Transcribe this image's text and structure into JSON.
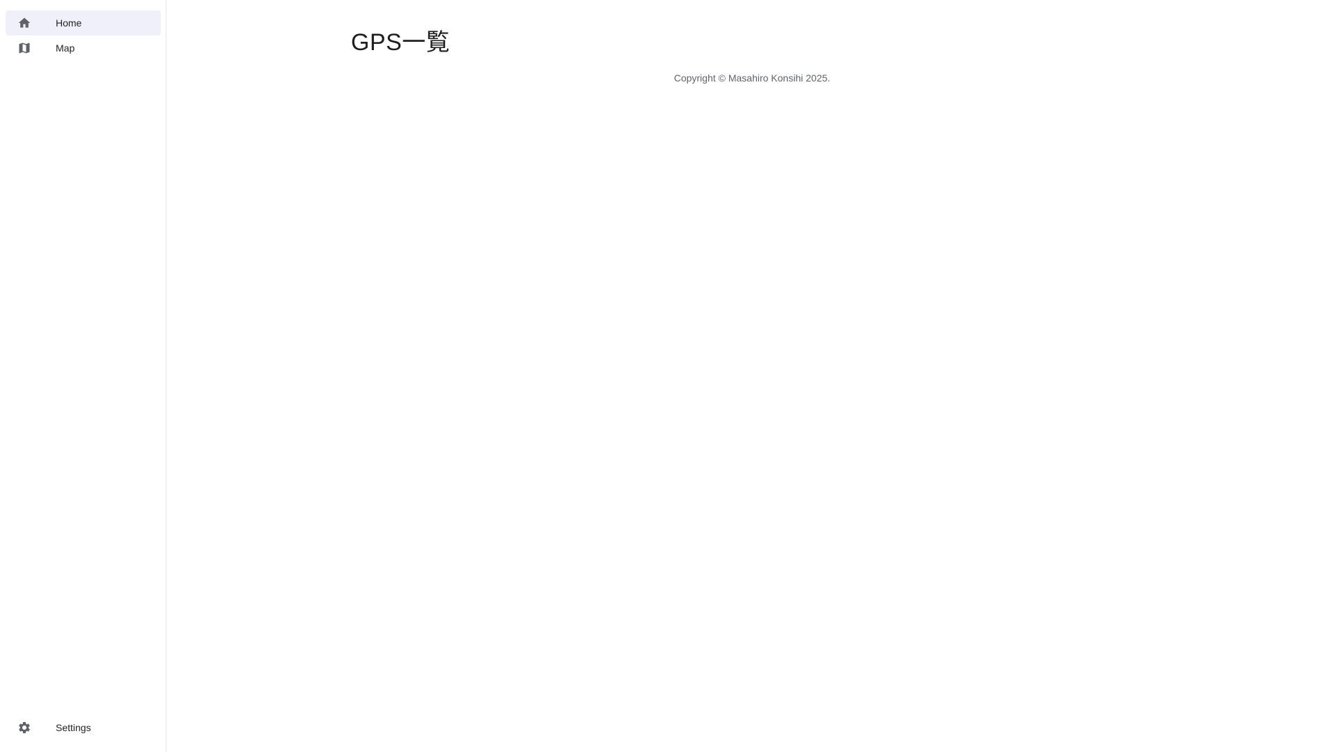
{
  "sidebar": {
    "items": [
      {
        "label": "Home",
        "icon": "home-icon",
        "active": true
      },
      {
        "label": "Map",
        "icon": "map-icon",
        "active": false
      }
    ],
    "bottom": {
      "label": "Settings",
      "icon": "gear-icon"
    }
  },
  "main": {
    "title": "GPS一覧",
    "copyright": "Copyright © Masahiro Konsihi 2025."
  },
  "colors": {
    "active_item_bg": "#eff0fa",
    "icon": "#5f6368",
    "text": "#1f1f1f",
    "muted_text": "#5f6368"
  }
}
